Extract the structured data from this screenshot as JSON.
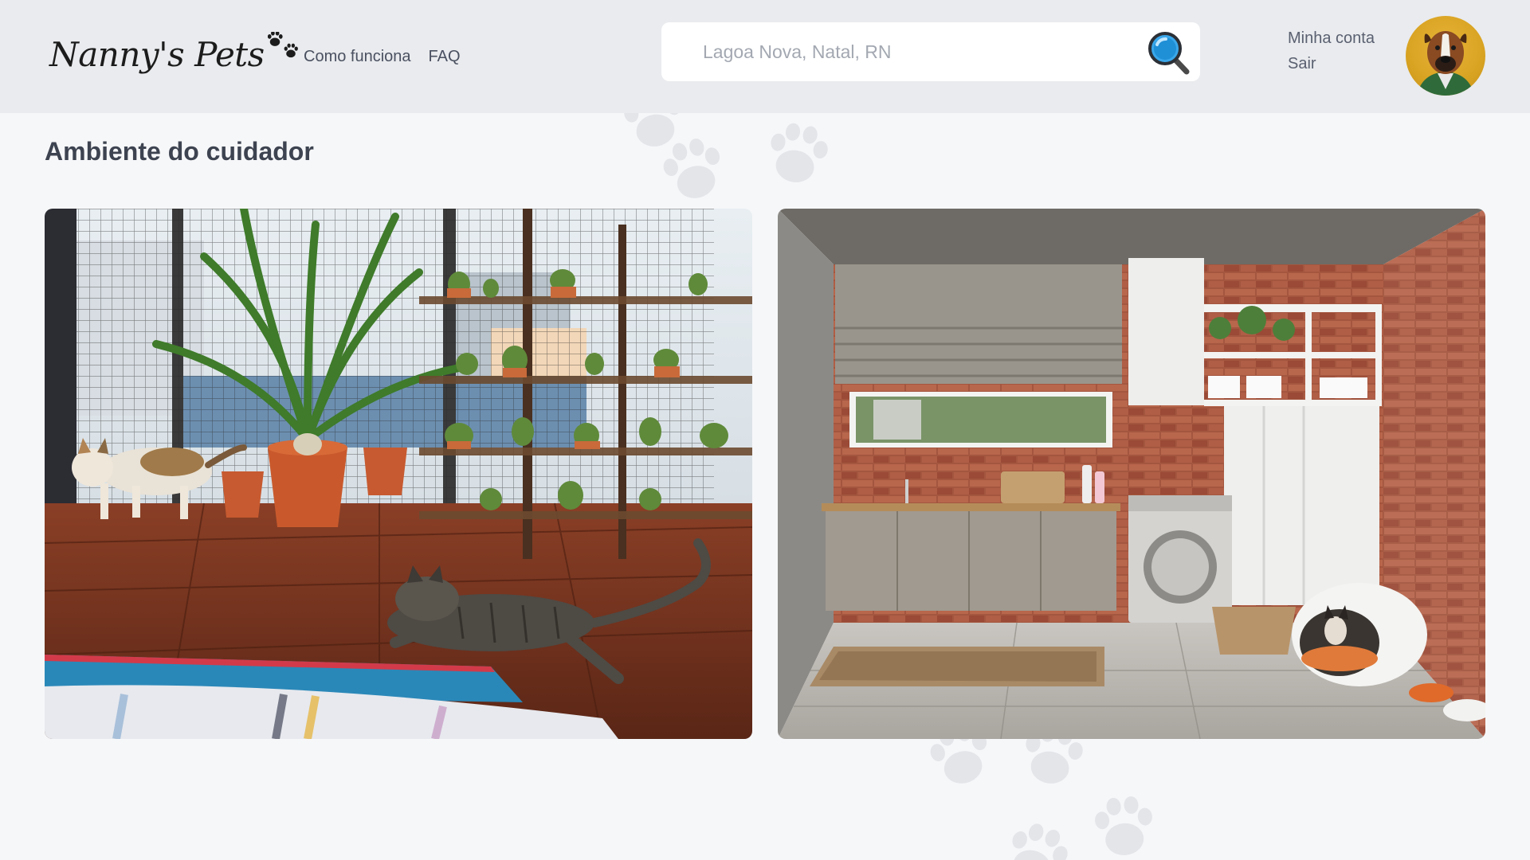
{
  "brand": {
    "name": "Nanny's Pets",
    "logo_icon": "paw-prints-icon"
  },
  "nav": {
    "items": [
      {
        "label": "Como funciona"
      },
      {
        "label": "FAQ"
      }
    ]
  },
  "search": {
    "value": "",
    "placeholder": "Lagoa Nova, Natal, RN",
    "icon": "magnifier-icon"
  },
  "account": {
    "my_account_label": "Minha conta",
    "logout_label": "Sair",
    "avatar": "dog-avatar"
  },
  "main": {
    "title": "Ambiente do cuidador",
    "photos": [
      {
        "name": "cats-balcony-photo",
        "alt": "Cats on a wooden balcony with plants and cacti"
      },
      {
        "name": "laundry-room-photo",
        "alt": "Laundry room with dog bed and brick wall"
      }
    ]
  },
  "colors": {
    "header_bg": "#e9ebee",
    "page_bg": "#f6f7f9",
    "accent": "#1f8fd6",
    "paw": "#e3e5e9"
  }
}
